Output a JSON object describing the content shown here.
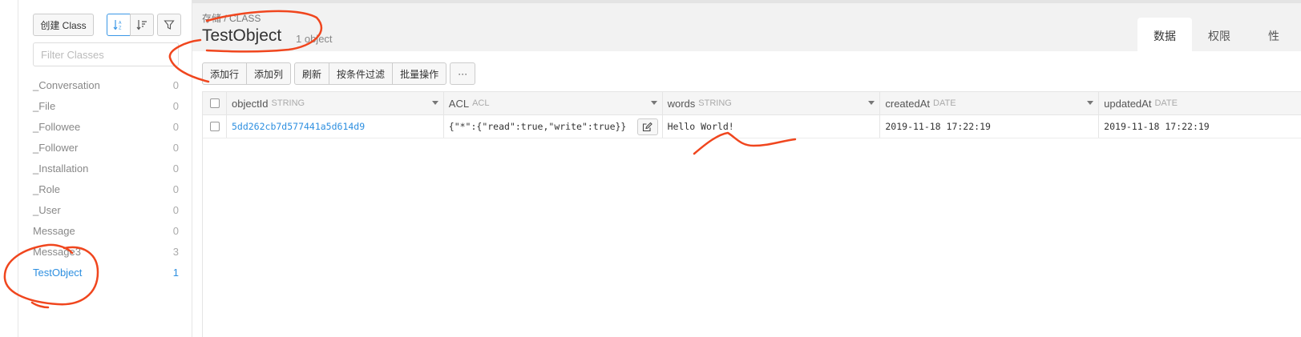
{
  "sidebar": {
    "create_label": "创建 Class",
    "filter_placeholder": "Filter Classes",
    "classes": [
      {
        "name": "_Conversation",
        "count": "0"
      },
      {
        "name": "_File",
        "count": "0"
      },
      {
        "name": "_Followee",
        "count": "0"
      },
      {
        "name": "_Follower",
        "count": "0"
      },
      {
        "name": "_Installation",
        "count": "0"
      },
      {
        "name": "_Role",
        "count": "0"
      },
      {
        "name": "_User",
        "count": "0"
      },
      {
        "name": "Message",
        "count": "0"
      },
      {
        "name": "Message3",
        "count": "3"
      },
      {
        "name": "TestObject",
        "count": "1"
      }
    ]
  },
  "header": {
    "breadcrumb": "存储 / CLASS",
    "title": "TestObject",
    "subtitle": "1 object",
    "tabs": [
      "数据",
      "权限",
      "性"
    ]
  },
  "toolbar": {
    "group1": [
      "添加行",
      "添加列"
    ],
    "group2": [
      "刷新",
      "按条件过滤",
      "批量操作"
    ],
    "more": "···"
  },
  "table": {
    "columns": [
      {
        "name": "objectId",
        "type": "STRING"
      },
      {
        "name": "ACL",
        "type": "ACL"
      },
      {
        "name": "words",
        "type": "STRING"
      },
      {
        "name": "createdAt",
        "type": "DATE"
      },
      {
        "name": "updatedAt",
        "type": "DATE"
      }
    ],
    "rows": [
      {
        "objectId": "5dd262cb7d577441a5d614d9",
        "acl": "{\"*\":{\"read\":true,\"write\":true}}",
        "words": "Hello World!",
        "createdAt": "2019-11-18 17:22:19",
        "updatedAt": "2019-11-18 17:22:19"
      }
    ]
  },
  "colors": {
    "accent": "#2d8fe0",
    "annotation": "#f0461e"
  },
  "icons": [
    "sort-az-icon",
    "sort-desc-icon",
    "filter-icon",
    "edit-icon",
    "caret-down-icon"
  ]
}
